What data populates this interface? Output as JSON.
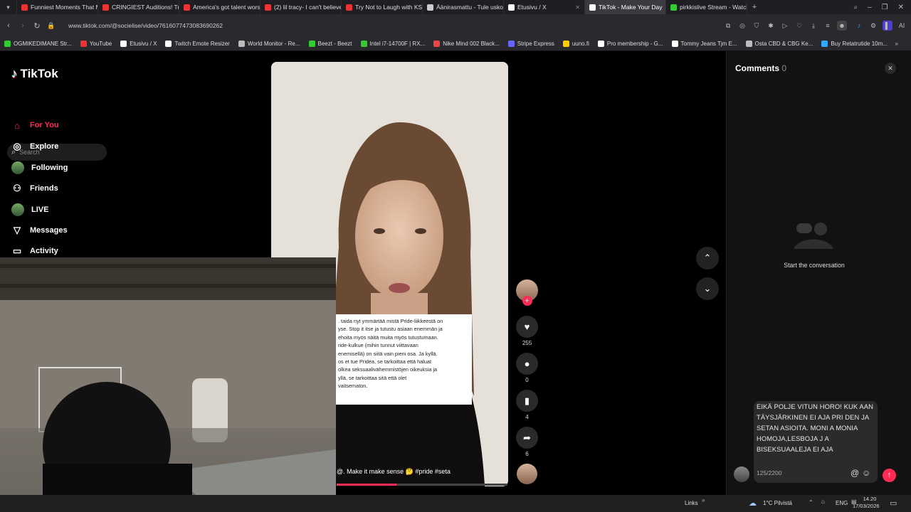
{
  "browser": {
    "tabs": [
      {
        "label": "Funniest Moments That M",
        "color": "#e33"
      },
      {
        "label": "CRINGIEST Auditions! Try",
        "color": "#e33"
      },
      {
        "label": "America's got talent worst",
        "color": "#e33"
      },
      {
        "label": "(2) lil tracy- I can't believe",
        "color": "#e33"
      },
      {
        "label": "Try Not to Laugh with KSI",
        "color": "#e33"
      },
      {
        "label": "Äänirasmattu - Tule uskoo",
        "color": "#ccc"
      },
      {
        "label": "Etusivu / X",
        "color": "#fff"
      },
      {
        "label": "TikTok - Make Your Day",
        "color": "#fff",
        "active": true
      },
      {
        "label": "pirkkislive Stream - Watch",
        "color": "#3c3"
      }
    ],
    "url": "www.tiktok.com/@socielise/video/7616077473083690262",
    "bookmarks": [
      {
        "label": "OGMIKEDIMANE Str...",
        "color": "#3c3"
      },
      {
        "label": "YouTube",
        "color": "#e33"
      },
      {
        "label": "Etusivu / X",
        "color": "#fff"
      },
      {
        "label": "Twitch Emote Resizer",
        "color": "#fff"
      },
      {
        "label": "World Monitor - Re...",
        "color": "#bbb"
      },
      {
        "label": "Beezt - Beezt",
        "color": "#3c3"
      },
      {
        "label": "Intel i7-14700F | RX...",
        "color": "#3c3"
      },
      {
        "label": "Nike Mind 002 Black...",
        "color": "#e44"
      },
      {
        "label": "Stripe Express",
        "color": "#66f"
      },
      {
        "label": "uuno.fi",
        "color": "#fc0"
      },
      {
        "label": "Pro membership - G...",
        "color": "#fff"
      },
      {
        "label": "Tommy Jeans Tjm E...",
        "color": "#fff"
      },
      {
        "label": "Osta CBD & CBG Ke...",
        "color": "#bbb"
      },
      {
        "label": "Buy Retatrutide 10m...",
        "color": "#3af"
      }
    ]
  },
  "tiktok": {
    "logo": "TikTok",
    "search_placeholder": "Search",
    "nav": [
      {
        "label": "For You",
        "icon": "home-icon",
        "active": true
      },
      {
        "label": "Explore",
        "icon": "compass-icon"
      },
      {
        "label": "Following",
        "icon": "following-avatar-icon"
      },
      {
        "label": "Friends",
        "icon": "friends-icon"
      },
      {
        "label": "LIVE",
        "icon": "live-icon"
      },
      {
        "label": "Messages",
        "icon": "messages-icon"
      },
      {
        "label": "Activity",
        "icon": "activity-icon"
      }
    ],
    "video": {
      "overlay_text": ". taida nyt ymmärtää mistä Pride-liikkeestä on\nyse. Stop it itse ja tutustu asiaan enemmän ja\nehoita myös näitä muita myös tutustumaan.\nride-kulkue (mihin tunnut viittavaan\nenemisellä) on siitä vain pieni osa. Ja kyllä.\nos et tue Pridea, se tarkoittaa että haluat\nolkea seksuaalivähemmistöjen oikeuksia ja\nyllä, se tarkoittaa sitä että olet\nvaitsematon.",
      "caption": "@. Make it make sense 🤔 #pride #seta",
      "progress": 0.35
    },
    "actions": {
      "likes": "255",
      "comments": "0",
      "saves": "4",
      "shares": "6"
    },
    "comments_panel": {
      "title": "Comments",
      "count": "0",
      "empty_text": "Start the conversation",
      "draft_text": "EIKÄ POLJE VITUN HORO! KUK AAN TÄYSJÄRKINEN EI AJA PRI DEN JA SETAN ASIOITA. MONI A MONIA HOMOJA,LESBOJA J A BISEKSUAALEJA EI AJA",
      "char_count": "125/2200"
    }
  },
  "taskbar": {
    "links": "Links",
    "weather": "1°C Pilvistä",
    "lang": "ENG",
    "time": "14.20",
    "date": "17/03/2026"
  }
}
